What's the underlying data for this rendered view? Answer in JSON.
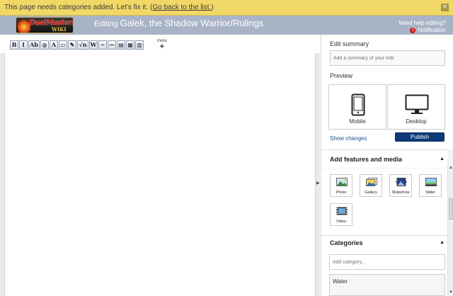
{
  "notice": {
    "text": "This page needs categories added. Let's fix it.",
    "link_open": "(",
    "link": "Go back to the list.",
    "link_close": ")",
    "close": "×"
  },
  "header": {
    "logo_top": "DuelMasters",
    "logo_bottom": "WIKI",
    "editing_label": "Editing",
    "page_title": "Galek, the Shadow Warrior/Rulings",
    "help": "Need help editing?",
    "notification_count": "1",
    "notification_label": "Notification"
  },
  "toolbar": {
    "tools": [
      "B",
      "I",
      "Ab",
      "◍",
      "A",
      "▭",
      "✎",
      "√n",
      "W",
      "~",
      "—",
      "▤",
      "▦",
      "▥"
    ],
    "more_label": "more",
    "more_plus": "+"
  },
  "rail": {
    "edit_summary_label": "Edit summary",
    "summary_placeholder": "Add a summary of your edit",
    "preview_label": "Preview",
    "mobile_label": "Mobile",
    "desktop_label": "Desktop",
    "show_changes": "Show changes",
    "publish": "Publish",
    "features_title": "Add features and media",
    "features": [
      {
        "label": "Photo",
        "icon": "photo-icon"
      },
      {
        "label": "Gallery",
        "icon": "gallery-icon"
      },
      {
        "label": "Slideshow",
        "icon": "slideshow-icon"
      },
      {
        "label": "Slider",
        "icon": "slider-icon"
      },
      {
        "label": "Video",
        "icon": "video-icon"
      }
    ],
    "categories_title": "Categories",
    "category_placeholder": "Add category...",
    "categories": [
      "Water"
    ]
  },
  "colors": {
    "notice_bg": "#f1d766",
    "header_bg": "#a8b4c6",
    "publish_bg": "#0e3a78",
    "link": "#1a4f8c"
  }
}
